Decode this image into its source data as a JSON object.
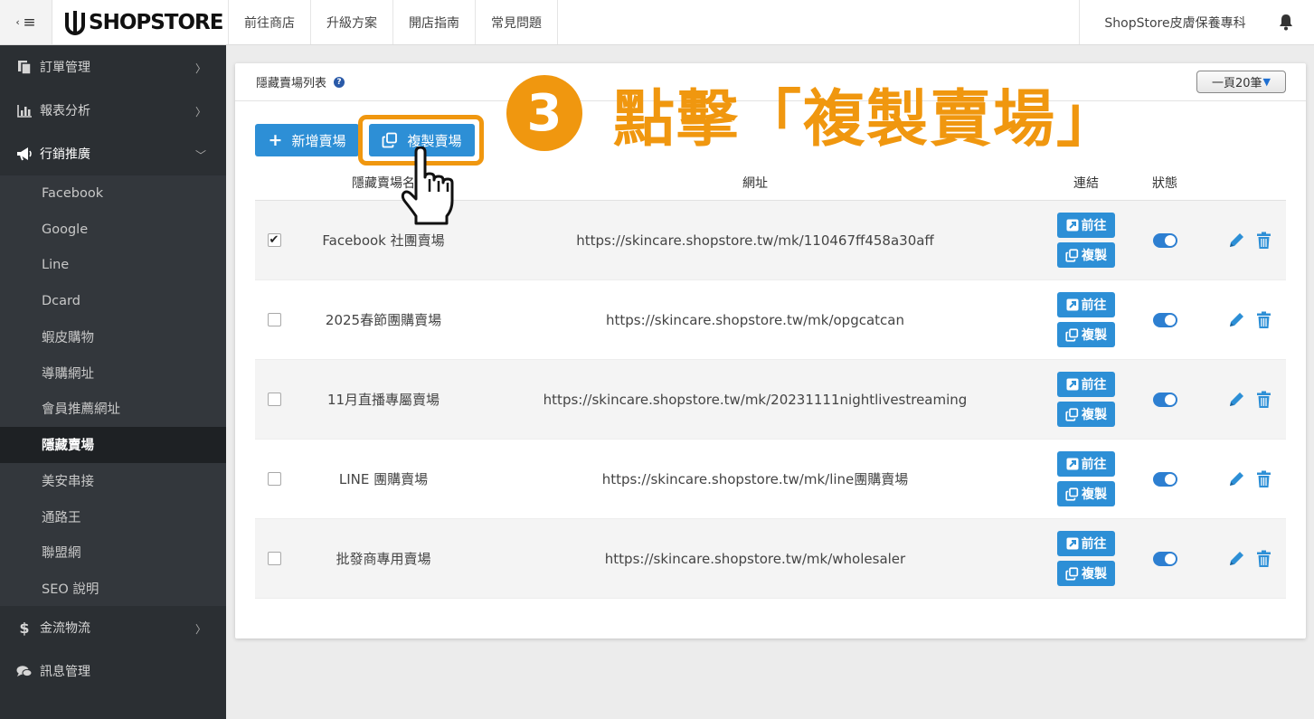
{
  "topbar": {
    "collapse_icon": "sidebar-toggle-icon",
    "logo_text": "SHOPSTORE",
    "nav": [
      "前往商店",
      "升級方案",
      "開店指南",
      "常見問題"
    ],
    "store_name": "ShopStore皮膚保養專科",
    "bell_icon": "bell-icon"
  },
  "sidebar": {
    "items": [
      {
        "label": "訂單管理",
        "icon": "orders-icon"
      },
      {
        "label": "報表分析",
        "icon": "bar-chart-icon"
      },
      {
        "label": "行銷推廣",
        "icon": "megaphone-icon"
      }
    ],
    "marketing_sub": [
      "Facebook",
      "Google",
      "Line",
      "Dcard",
      "蝦皮購物",
      "導購網址",
      "會員推薦網址",
      "隱藏賣場",
      "美安串接",
      "通路王",
      "聯盟網",
      "SEO 說明"
    ],
    "active_sub": "隱藏賣場",
    "bottom_items": [
      {
        "label": "金流物流",
        "icon": "dollar-icon"
      },
      {
        "label": "訊息管理",
        "icon": "comments-icon"
      }
    ]
  },
  "card": {
    "title": "隱藏賣場列表",
    "per_page": "一頁20筆",
    "add_button": "新增賣場",
    "copy_button": "複製賣場",
    "annotation_step": "3",
    "annotation_text": "點擊「複製賣場」"
  },
  "table": {
    "headers": {
      "name": "隱藏賣場名",
      "url": "網址",
      "link": "連結",
      "status": "狀態"
    },
    "go_label": "前往",
    "copy_label": "複製",
    "rows": [
      {
        "checked": true,
        "name": "Facebook 社團賣場",
        "url": "https://skincare.shopstore.tw/mk/110467ff458a30aff",
        "status": "on"
      },
      {
        "checked": false,
        "name": "2025春節團購賣場",
        "url": "https://skincare.shopstore.tw/mk/opgcatcan",
        "status": "on"
      },
      {
        "checked": false,
        "name": "11月直播專屬賣場",
        "url": "https://skincare.shopstore.tw/mk/20231111nightlivestreaming",
        "status": "on"
      },
      {
        "checked": false,
        "name": "LINE 團購賣場",
        "url": "https://skincare.shopstore.tw/mk/line團購賣場",
        "status": "on"
      },
      {
        "checked": false,
        "name": "批發商專用賣場",
        "url": "https://skincare.shopstore.tw/mk/wholesaler",
        "status": "on"
      }
    ]
  },
  "colors": {
    "accent": "#2d8fd6",
    "annotation": "#f0970f",
    "sidebar": "#2b2f33"
  }
}
